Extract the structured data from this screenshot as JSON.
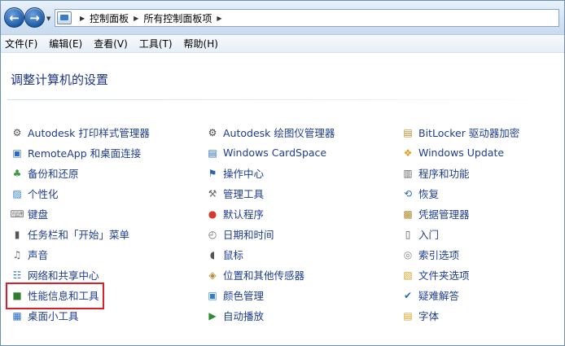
{
  "breadcrumb": [
    "控制面板",
    "所有控制面板项"
  ],
  "menu": [
    "文件(F)",
    "编辑(E)",
    "查看(V)",
    "工具(T)",
    "帮助(H)"
  ],
  "heading": "调整计算机的设置",
  "columns": [
    [
      {
        "label": "Autodesk 打印样式管理器",
        "icon": "printer-style-icon"
      },
      {
        "label": "RemoteApp 和桌面连接",
        "icon": "remoteapp-icon"
      },
      {
        "label": "备份和还原",
        "icon": "backup-icon"
      },
      {
        "label": "个性化",
        "icon": "personalize-icon"
      },
      {
        "label": "键盘",
        "icon": "keyboard-icon"
      },
      {
        "label": "任务栏和「开始」菜单",
        "icon": "taskbar-icon"
      },
      {
        "label": "声音",
        "icon": "speaker-icon"
      },
      {
        "label": "网络和共享中心",
        "icon": "network-icon"
      },
      {
        "label": "性能信息和工具",
        "icon": "performance-icon"
      },
      {
        "label": "桌面小工具",
        "icon": "gadgets-icon"
      }
    ],
    [
      {
        "label": "Autodesk 绘图仪管理器",
        "icon": "plotter-icon"
      },
      {
        "label": "Windows CardSpace",
        "icon": "cardspace-icon"
      },
      {
        "label": "操作中心",
        "icon": "flag-icon"
      },
      {
        "label": "管理工具",
        "icon": "admin-tools-icon"
      },
      {
        "label": "默认程序",
        "icon": "default-programs-icon"
      },
      {
        "label": "日期和时间",
        "icon": "clock-icon"
      },
      {
        "label": "鼠标",
        "icon": "mouse-icon"
      },
      {
        "label": "位置和其他传感器",
        "icon": "sensor-icon"
      },
      {
        "label": "颜色管理",
        "icon": "color-icon"
      },
      {
        "label": "自动播放",
        "icon": "autoplay-icon"
      }
    ],
    [
      {
        "label": "BitLocker 驱动器加密",
        "icon": "bitlocker-icon"
      },
      {
        "label": "Windows Update",
        "icon": "windows-update-icon"
      },
      {
        "label": "程序和功能",
        "icon": "programs-icon"
      },
      {
        "label": "恢复",
        "icon": "recovery-icon"
      },
      {
        "label": "凭据管理器",
        "icon": "credential-icon"
      },
      {
        "label": "入门",
        "icon": "getting-started-icon"
      },
      {
        "label": "索引选项",
        "icon": "index-icon"
      },
      {
        "label": "文件夹选项",
        "icon": "folder-icon"
      },
      {
        "label": "疑难解答",
        "icon": "troubleshoot-icon"
      },
      {
        "label": "字体",
        "icon": "font-icon"
      }
    ]
  ],
  "icon_colors": {
    "printer-style-icon": "#555555",
    "remoteapp-icon": "#2a6bc0",
    "backup-icon": "#3f9a3f",
    "personalize-icon": "#2d7fd0",
    "keyboard-icon": "#7a7a7a",
    "taskbar-icon": "#555555",
    "speaker-icon": "#666666",
    "network-icon": "#3a7bc8",
    "performance-icon": "#2e7d2e",
    "gadgets-icon": "#2a6bc0",
    "plotter-icon": "#444444",
    "cardspace-icon": "#2a6bc0",
    "flag-icon": "#2a5fb5",
    "admin-tools-icon": "#6b6b6b",
    "default-programs-icon": "#d23b2b",
    "clock-icon": "#666666",
    "mouse-icon": "#555555",
    "sensor-icon": "#b08a2a",
    "color-icon": "#2d7fd0",
    "autoplay-icon": "#2e8b2e",
    "bitlocker-icon": "#b58b2a",
    "windows-update-icon": "#e0a020",
    "programs-icon": "#666666",
    "recovery-icon": "#2a6bc0",
    "credential-icon": "#b08a2a",
    "getting-started-icon": "#555555",
    "index-icon": "#888888",
    "folder-icon": "#d6a42a",
    "troubleshoot-icon": "#2a6bc0",
    "font-icon": "#d6a42a"
  },
  "highlight_color": "#d9202a"
}
